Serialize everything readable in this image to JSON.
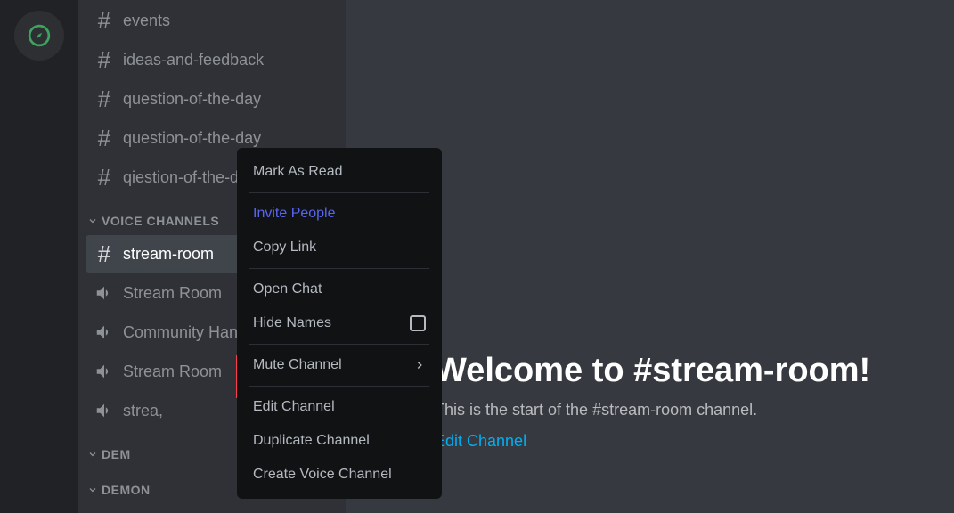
{
  "sidebar": {
    "text_channels": [
      "events",
      "ideas-and-feedback",
      "question-of-the-day",
      "question-of-the-day",
      "qiestion-of-the-day"
    ],
    "voice_category_label": "VOICE CHANNELS",
    "voice_channels": [
      {
        "name": "stream-room",
        "type": "text",
        "selected": true
      },
      {
        "name": "Stream Room",
        "type": "voice"
      },
      {
        "name": "Community Hangout",
        "type": "voice"
      },
      {
        "name": "Stream Room",
        "type": "voice"
      },
      {
        "name": "strea,",
        "type": "voice"
      }
    ],
    "categories": [
      "DEM",
      "DEMON"
    ]
  },
  "context_menu": {
    "mark_as_read": "Mark As Read",
    "invite_people": "Invite People",
    "copy_link": "Copy Link",
    "open_chat": "Open Chat",
    "hide_names": "Hide Names",
    "mute_channel": "Mute Channel",
    "edit_channel": "Edit Channel",
    "duplicate_channel": "Duplicate Channel",
    "create_voice_channel": "Create Voice Channel"
  },
  "main": {
    "welcome_title": "Welcome to #stream-room!",
    "welcome_sub": "This is the start of the #stream-room channel.",
    "edit_link": "Edit Channel"
  }
}
